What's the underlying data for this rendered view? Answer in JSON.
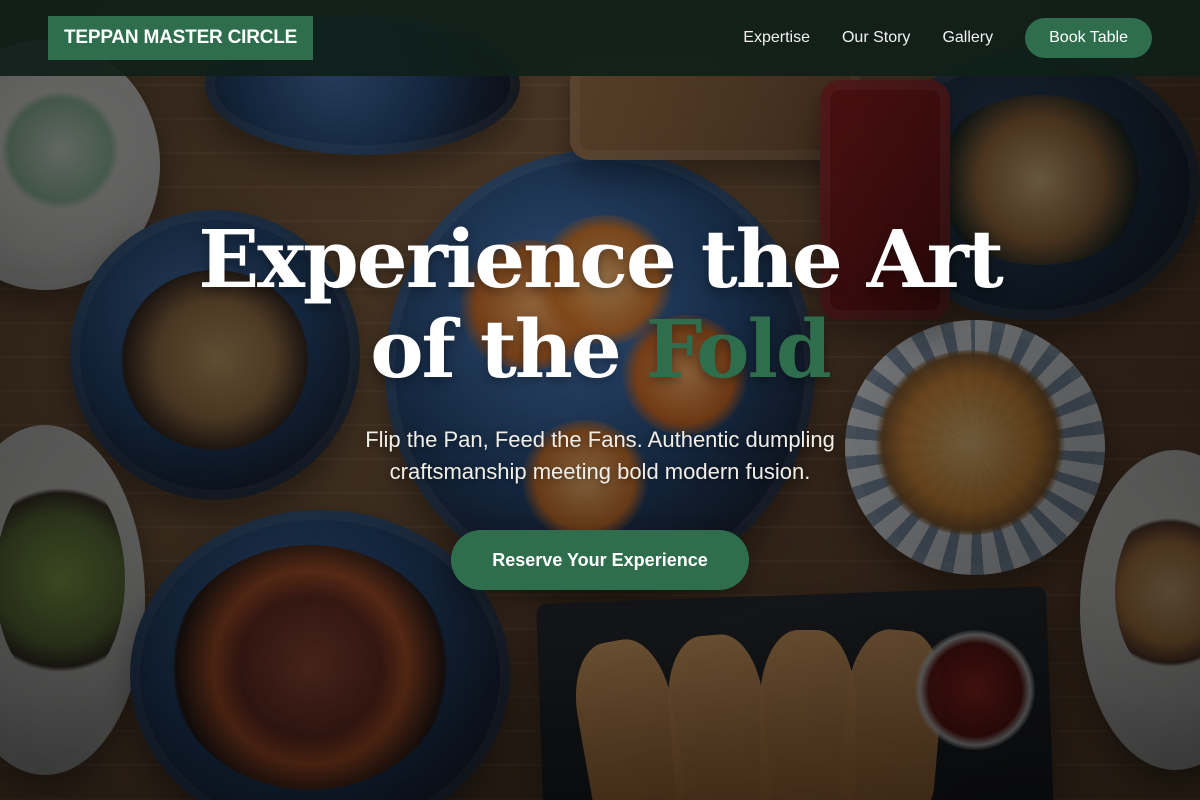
{
  "brand": {
    "name": "TEPPAN MASTER CIRCLE"
  },
  "nav": {
    "links": [
      {
        "label": "Expertise"
      },
      {
        "label": "Our Story"
      },
      {
        "label": "Gallery"
      }
    ],
    "book_label": "Book Table"
  },
  "hero": {
    "headline_part1": "Experience the Art",
    "headline_part2": "of the",
    "headline_accent": "Fold",
    "subtitle": "Flip the Pan, Feed the Fans. Authentic dumpling craftsmanship meeting bold modern fusion.",
    "cta_label": "Reserve Your Experience"
  },
  "colors": {
    "accent": "#2f6e4d",
    "nav_bg": "#0f1f19"
  }
}
